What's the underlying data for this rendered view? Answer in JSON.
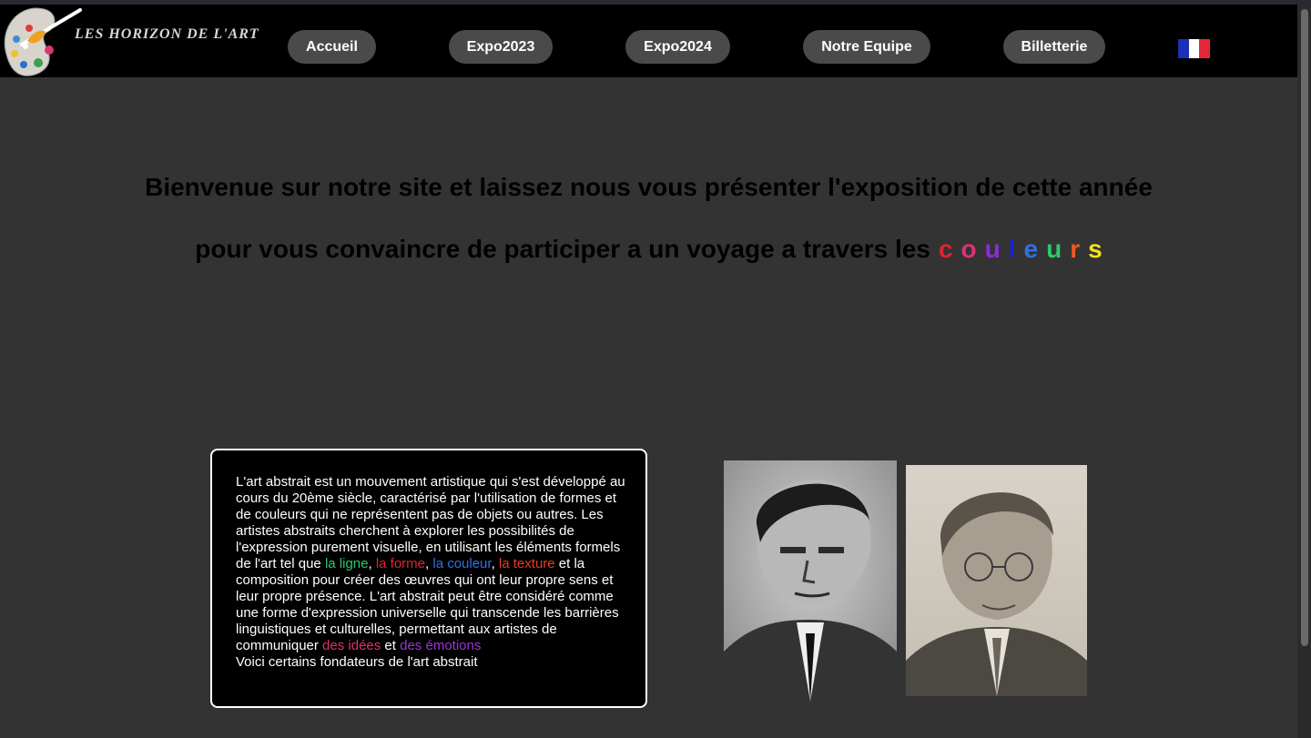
{
  "header": {
    "brand": "LES HORIZON DE L'ART",
    "nav": [
      "Accueil",
      "Expo2023",
      "Expo2024",
      "Notre Equipe",
      "Billetterie"
    ],
    "flag_colors": [
      "#1e2fb8",
      "#ffffff",
      "#e4283a"
    ]
  },
  "hero": {
    "line1": "Bienvenue sur notre site et laissez nous vous présenter l'exposition de cette année",
    "line2": "pour vous convaincre de participer a un voyage a travers les",
    "colored_word": [
      {
        "letter": "c",
        "color": "#e3222f"
      },
      {
        "letter": "o",
        "color": "#e0307a"
      },
      {
        "letter": "u",
        "color": "#8a2be2"
      },
      {
        "letter": "l",
        "color": "#1e1ed2"
      },
      {
        "letter": "e",
        "color": "#2f6fe3"
      },
      {
        "letter": "u",
        "color": "#2ec86a"
      },
      {
        "letter": "r",
        "color": "#ee5a1e"
      },
      {
        "letter": "s",
        "color": "#f4e21d"
      }
    ]
  },
  "article": {
    "t1": "L'art abstrait est un mouvement artistique qui s'est développé au cours du 20ème siècle, caractérisé par l'utilisation de formes et de couleurs qui ne représentent pas de objets ou autres. Les artistes abstraits cherchent à explorer les possibilités de l'expression purement visuelle, en utilisant les éléments formels de l'art tel que ",
    "ligne": "la ligne",
    "c1": ", ",
    "forme": "la forme",
    "c2": ", ",
    "couleur": "la couleur",
    "c3": ", ",
    "texture": "la texture",
    "t2": " et la composition pour créer des œuvres qui ont leur propre sens et leur propre présence. L'art abstrait peut être considéré comme une forme d'expression universelle qui transcende les barrières linguistiques et culturelles, permettant aux artistes de communiquer ",
    "idees": "des idées",
    "et": " et ",
    "emotions": "des émotions",
    "t3": "Voici certains fondateurs de l'art abstrait",
    "colors": {
      "ligne": "#2ec86a",
      "forme": "#e3222f",
      "couleur": "#2f6fe3",
      "texture": "#ee3a1e",
      "idees": "#e0306f",
      "emotions": "#9b35d6"
    }
  }
}
